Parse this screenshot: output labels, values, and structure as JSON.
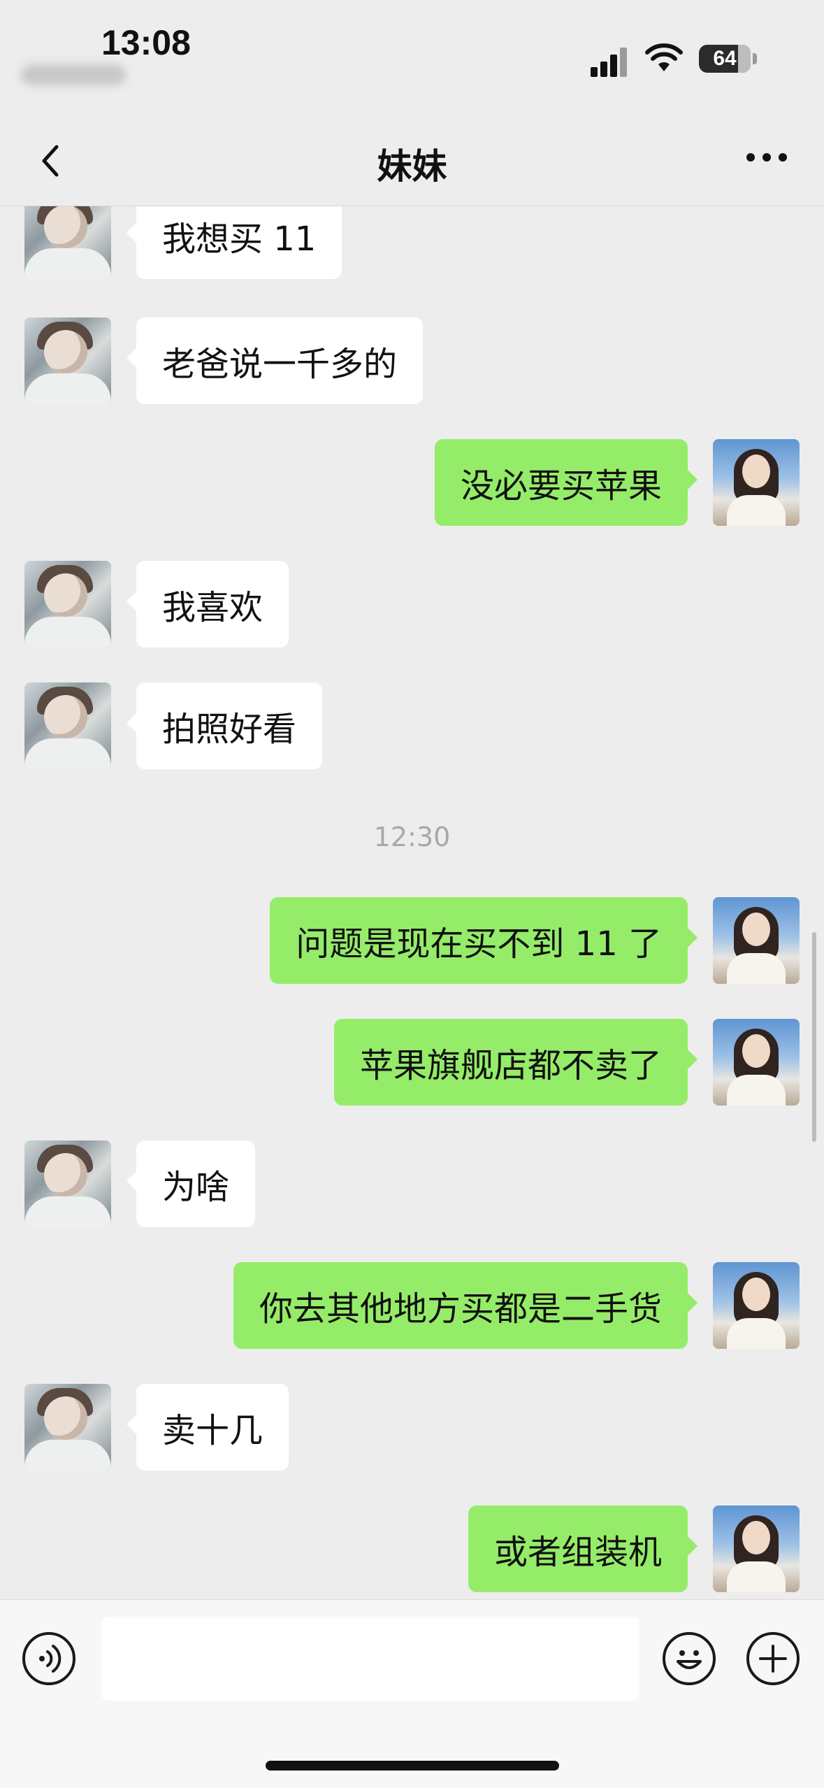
{
  "status_bar": {
    "time": "13:08",
    "battery": "64"
  },
  "nav": {
    "title": "妹妹"
  },
  "messages": [
    {
      "side": "left",
      "text": "我想买 11"
    },
    {
      "side": "left",
      "text": "老爸说一千多的"
    },
    {
      "side": "right",
      "text": "没必要买苹果"
    },
    {
      "side": "left",
      "text": "我喜欢"
    },
    {
      "side": "left",
      "text": "拍照好看"
    },
    {
      "side": "right",
      "text": "问题是现在买不到 11 了"
    },
    {
      "side": "right",
      "text": "苹果旗舰店都不卖了"
    },
    {
      "side": "left",
      "text": "为啥"
    },
    {
      "side": "right",
      "text": "你去其他地方买都是二手货"
    },
    {
      "side": "left",
      "text": "卖十几"
    },
    {
      "side": "right",
      "text": "或者组装机"
    }
  ],
  "timestamp": "12:30",
  "input": {
    "value": ""
  },
  "colors": {
    "background": "#ededed",
    "bubble_self": "#95ec69",
    "bubble_other": "#ffffff"
  },
  "icons": [
    "back-icon",
    "more-icon",
    "voice-icon",
    "emoji-icon",
    "plus-icon"
  ]
}
